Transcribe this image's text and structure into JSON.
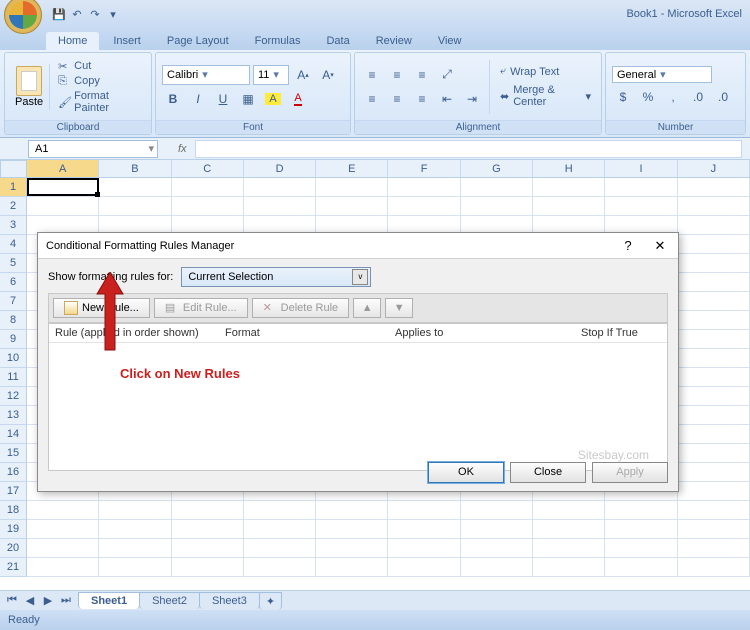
{
  "app": {
    "title": "Book1 - Microsoft Excel"
  },
  "qat": {
    "save": "💾",
    "undo": "↶",
    "redo": "↷"
  },
  "tabs": [
    "Home",
    "Insert",
    "Page Layout",
    "Formulas",
    "Data",
    "Review",
    "View"
  ],
  "ribbon": {
    "clipboard": {
      "paste": "Paste",
      "cut": "Cut",
      "copy": "Copy",
      "formatPainter": "Format Painter",
      "label": "Clipboard"
    },
    "font": {
      "name": "Calibri",
      "size": "11",
      "label": "Font",
      "bold": "B",
      "italic": "I",
      "underline": "U"
    },
    "alignment": {
      "wrap": "Wrap Text",
      "merge": "Merge & Center",
      "label": "Alignment"
    },
    "number": {
      "format": "General",
      "label": "Number"
    }
  },
  "nameBox": "A1",
  "fx": "fx",
  "columns": [
    "A",
    "B",
    "C",
    "D",
    "E",
    "F",
    "G",
    "H",
    "I",
    "J"
  ],
  "rows": [
    "1",
    "2",
    "3",
    "4",
    "5",
    "6",
    "7",
    "8",
    "9",
    "10",
    "11",
    "12",
    "13",
    "14",
    "15",
    "16",
    "17",
    "18",
    "19",
    "20",
    "21"
  ],
  "sheets": [
    "Sheet1",
    "Sheet2",
    "Sheet3"
  ],
  "status": "Ready",
  "dialog": {
    "title": "Conditional Formatting Rules Manager",
    "showLabel": "Show formatting rules for:",
    "scope": "Current Selection",
    "newRule": "New Rule...",
    "editRule": "Edit Rule...",
    "deleteRule": "Delete Rule",
    "hdr": {
      "rule": "Rule (applied in order shown)",
      "format": "Format",
      "applies": "Applies to",
      "stop": "Stop If True"
    },
    "ok": "OK",
    "close": "Close",
    "apply": "Apply",
    "watermark": "Sitesbay.com"
  },
  "annotation": "Click on New Rules"
}
